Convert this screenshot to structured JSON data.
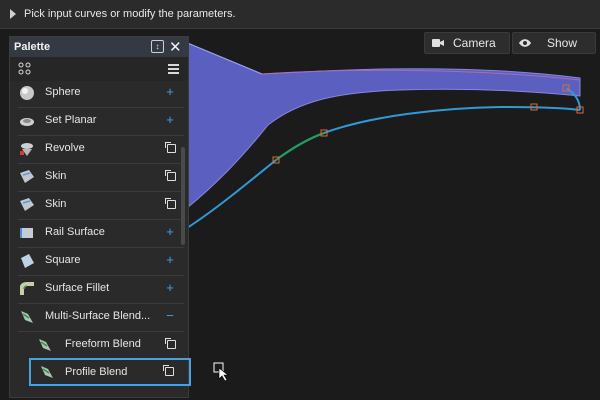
{
  "prompt": {
    "text": "Pick input curves or modify the parameters."
  },
  "viewport_buttons": {
    "camera": "Camera",
    "show": "Show"
  },
  "palette": {
    "title": "Palette",
    "items": [
      {
        "label": "Sphere",
        "icon": "sphere-icon",
        "action": "add"
      },
      {
        "label": "Set Planar",
        "icon": "set-planar-icon",
        "action": "add"
      },
      {
        "label": "Revolve",
        "icon": "revolve-icon",
        "action": "copy"
      },
      {
        "label": "Skin",
        "icon": "skin-icon",
        "action": "copy"
      },
      {
        "label": "Skin",
        "icon": "skin-icon",
        "action": "copy"
      },
      {
        "label": "Rail Surface",
        "icon": "rail-surface-icon",
        "action": "add"
      },
      {
        "label": "Square",
        "icon": "square-icon",
        "action": "add"
      },
      {
        "label": "Surface Fillet",
        "icon": "surface-fillet-icon",
        "action": "add"
      },
      {
        "label": "Multi-Surface Blend...",
        "icon": "multi-surface-blend-icon",
        "action": "collapse"
      },
      {
        "label": "Freeform Blend",
        "icon": "freeform-blend-icon",
        "action": "copy"
      },
      {
        "label": "Profile Blend",
        "icon": "profile-blend-icon",
        "action": "copy",
        "selected": true
      }
    ]
  },
  "colors": {
    "accent": "#3da5e8",
    "surface": "#5a5fc0",
    "curve": "#2f9ad8",
    "curve_highlight": "#1fa05a",
    "cv_point": "#e06a3a"
  }
}
